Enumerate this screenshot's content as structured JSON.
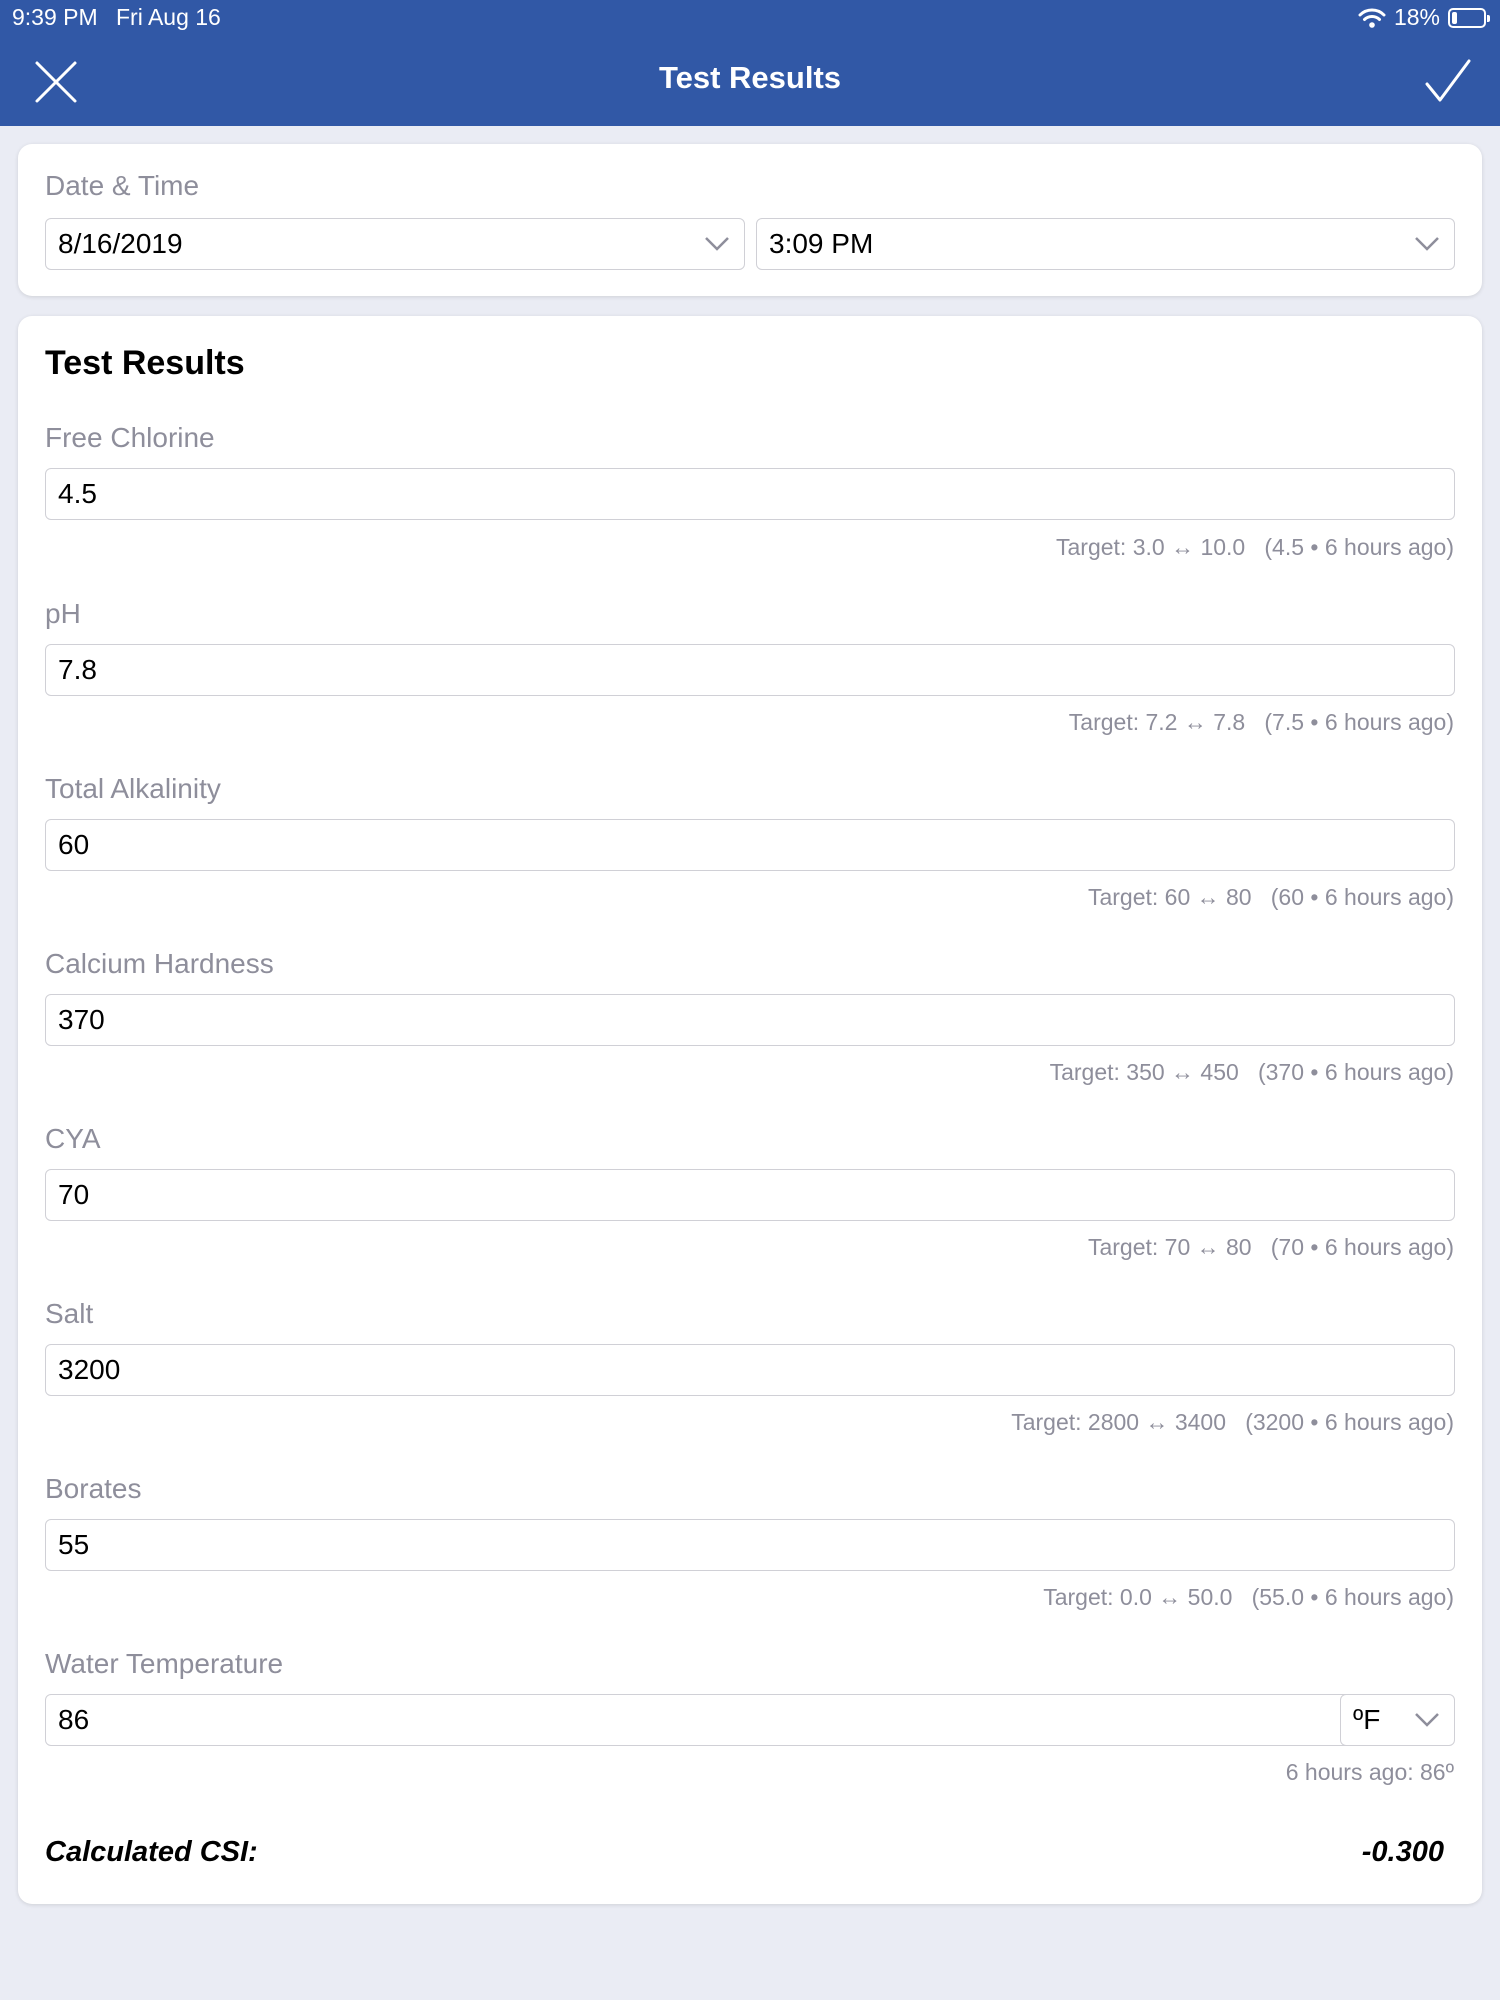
{
  "status": {
    "time": "9:39 PM",
    "date": "Fri Aug 16",
    "battery": "18%",
    "battery_level": 0.18
  },
  "header": {
    "title": "Test Results"
  },
  "datetime": {
    "label": "Date & Time",
    "date": "8/16/2019",
    "time": "3:09 PM"
  },
  "tests": {
    "title": "Test Results",
    "free_chlorine": {
      "label": "Free Chlorine",
      "value": "4.5",
      "hint": "Target: 3.0 ↔ 10.0   (4.5 • 6 hours ago)"
    },
    "ph": {
      "label": "pH",
      "value": "7.8",
      "hint": "Target: 7.2 ↔ 7.8   (7.5 • 6 hours ago)"
    },
    "total_alkalinity": {
      "label": "Total Alkalinity",
      "value": "60",
      "hint": "Target: 60 ↔ 80   (60 • 6 hours ago)"
    },
    "calcium_hardness": {
      "label": "Calcium Hardness",
      "value": "370",
      "hint": "Target: 350 ↔ 450   (370 • 6 hours ago)"
    },
    "cya": {
      "label": "CYA",
      "value": "70",
      "hint": "Target: 70 ↔ 80   (70 • 6 hours ago)"
    },
    "salt": {
      "label": "Salt",
      "value": "3200",
      "hint": "Target: 2800 ↔ 3400   (3200 • 6 hours ago)"
    },
    "borates": {
      "label": "Borates",
      "value": "55",
      "hint": "Target: 0.0 ↔ 50.0   (55.0 • 6 hours ago)"
    },
    "water_temperature": {
      "label": "Water Temperature",
      "value": "86",
      "unit": "ºF",
      "hint": "6 hours ago: 86º"
    },
    "csi_label": "Calculated CSI:",
    "csi_value": "-0.300"
  }
}
